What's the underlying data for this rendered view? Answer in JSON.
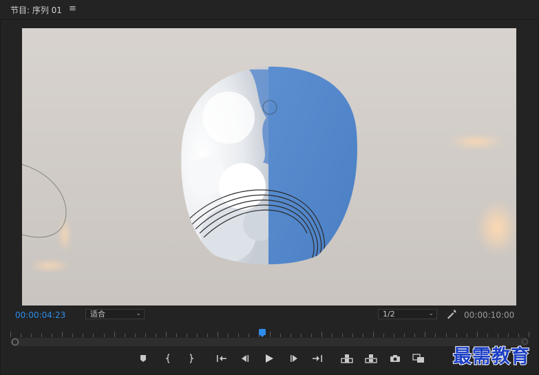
{
  "panel": {
    "title": "节目: 序列 01",
    "menu_icon": "hamburger-menu-icon"
  },
  "controls": {
    "current_timecode": "00:00:04:23",
    "zoom_value": "适合",
    "resolution_value": "1/2",
    "duration_timecode": "00:00:10:00",
    "settings_icon": "wrench-icon"
  },
  "timeline": {
    "playhead_fraction": 0.486
  },
  "transport": [
    {
      "name": "add-marker-button",
      "icon": "marker-icon"
    },
    {
      "name": "mark-in-button",
      "icon": "mark-in-icon"
    },
    {
      "name": "mark-out-button",
      "icon": "mark-out-icon"
    },
    {
      "name": "go-to-in-button",
      "icon": "go-to-in-icon"
    },
    {
      "name": "step-back-button",
      "icon": "step-back-icon"
    },
    {
      "name": "play-button",
      "icon": "play-icon"
    },
    {
      "name": "step-forward-button",
      "icon": "step-forward-icon"
    },
    {
      "name": "go-to-out-button",
      "icon": "go-to-out-icon"
    },
    {
      "name": "lift-button",
      "icon": "lift-icon"
    },
    {
      "name": "extract-button",
      "icon": "extract-icon"
    },
    {
      "name": "export-frame-button",
      "icon": "camera-icon"
    },
    {
      "name": "comparison-view-button",
      "icon": "comparison-view-icon"
    }
  ],
  "watermark": "最需教育",
  "colors": {
    "accent": "#2d8ceb",
    "background": "#232323",
    "watermark": "#1c3fc4"
  }
}
